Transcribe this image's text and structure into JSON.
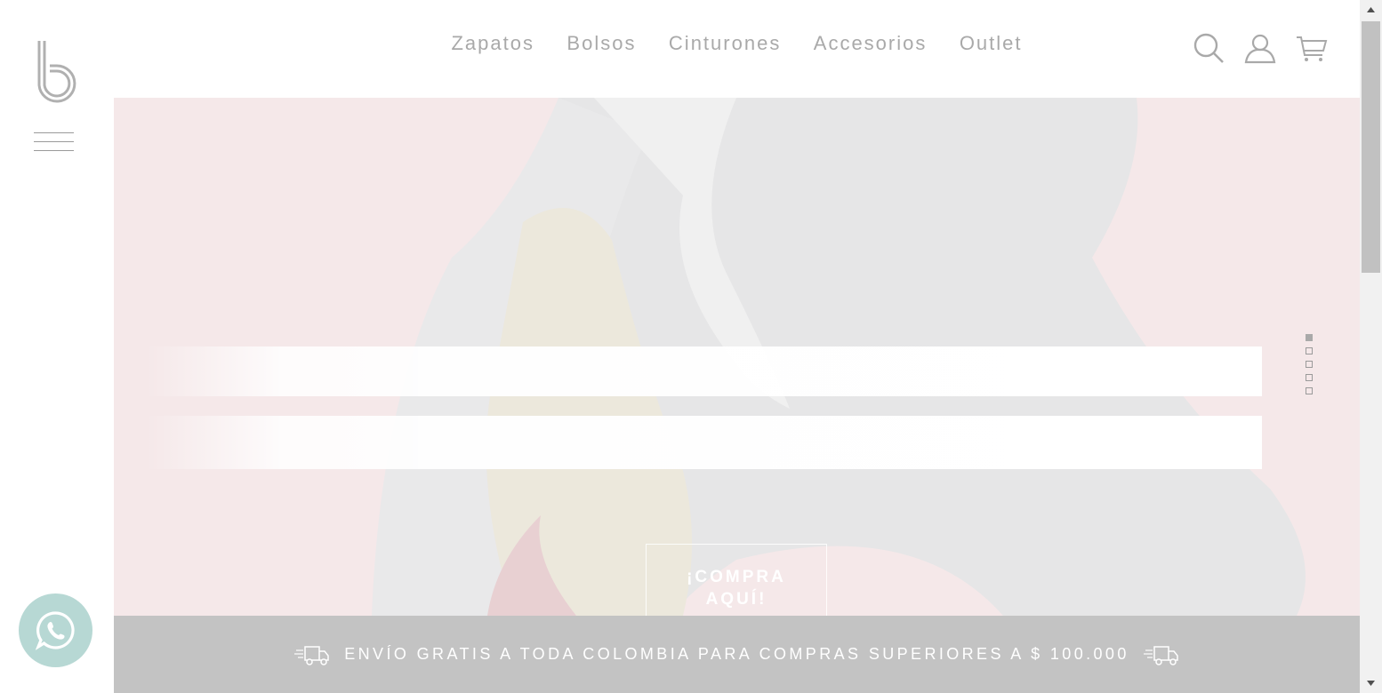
{
  "brand": {
    "logo_icon": "b-monogram-logo"
  },
  "nav": {
    "items": [
      {
        "label": "Zapatos"
      },
      {
        "label": "Bolsos"
      },
      {
        "label": "Cinturones"
      },
      {
        "label": "Accesorios"
      },
      {
        "label": "Outlet"
      }
    ]
  },
  "header_icons": [
    "search-icon",
    "user-icon",
    "cart-icon"
  ],
  "hero": {
    "cta_line1": "¡COMPRA",
    "cta_line2": "AQUÍ!",
    "slides_total": 5,
    "active_slide": 1
  },
  "shipping_banner": {
    "text": "ENVÍO GRATIS A TODA COLOMBIA PARA COMPRAS SUPERIORES A $ 100.000",
    "icon": "delivery-truck-icon"
  },
  "whatsapp": {
    "icon": "whatsapp-icon"
  },
  "colors": {
    "nav_text": "#a9a9a9",
    "hero_bg": "#f5e8e9",
    "banner_bg": "#c3c3c3",
    "whatsapp_bg": "#b7d8d4"
  }
}
